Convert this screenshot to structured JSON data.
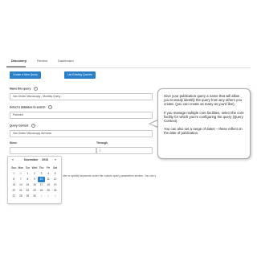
{
  "tabs": [
    "Discovery",
    "Review",
    "Dashboard"
  ],
  "buttons": {
    "create": "Create a New Query",
    "list": "List Existing Queries"
  },
  "form": {
    "name_label": "Name this query",
    "name_value": "Van Orden Microscopy - Monthly Query",
    "database_label": "Select a database to search",
    "database_value": "Pubmed",
    "context_label": "Query Context",
    "context_value": "Van Orden Microscopy Services",
    "since_label": "Since",
    "through_label": "Through",
    "info_symbol": "i"
  },
  "partial_text": "nter or specify keywords under the custom query parameters section. You can s",
  "callout": {
    "p1": "Give your publication query a name that will allow you to easily identify the query from any others you create. (you can create as many as you'd like).",
    "p2": "If you manage multiple core facilities, select the core facility for which you're configuring the query (Query Context).",
    "p3": "You can also set a range of dates – these reflect on the date of publication."
  },
  "calendar": {
    "month": "November",
    "year": "2016",
    "prev": "«",
    "next": "»",
    "weekdays": [
      "Sun",
      "Mon",
      "Tue",
      "Wed",
      "Thu",
      "Fri",
      "Sat"
    ],
    "weeks": [
      [
        "30",
        "31",
        "1",
        "2",
        "3",
        "4",
        "5"
      ],
      [
        "6",
        "7",
        "8",
        "9",
        "10",
        "11",
        "12"
      ],
      [
        "13",
        "14",
        "15",
        "16",
        "17",
        "18",
        "19"
      ],
      [
        "20",
        "21",
        "22",
        "23",
        "24",
        "25",
        "26"
      ],
      [
        "27",
        "28",
        "29",
        "30",
        "1",
        "2",
        "3"
      ]
    ],
    "selected": "10",
    "colors": {
      "selected": "#2a7fc9"
    }
  },
  "colors": {
    "button": "#2a7fc9"
  }
}
